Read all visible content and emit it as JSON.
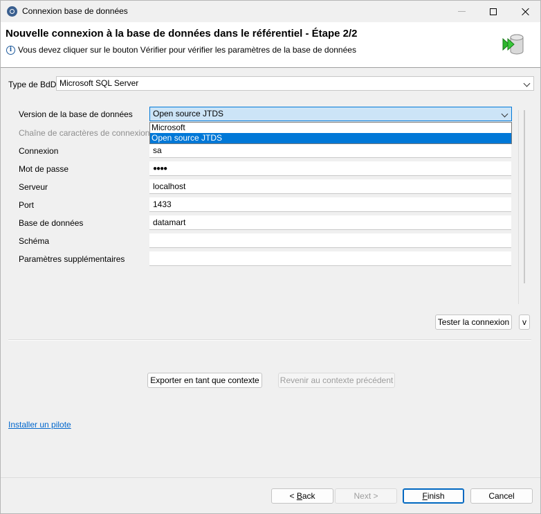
{
  "window": {
    "title": "Connexion base de données",
    "controls": {
      "minimize": "minimize-icon",
      "maximize": "maximize-icon",
      "close": "close-icon"
    }
  },
  "header": {
    "title": "Nouvelle connexion à la base de données dans le référentiel - Étape 2/2",
    "description": "Vous devez cliquer sur le bouton Vérifier pour vérifier les paramètres de la base de données",
    "info_icon": "i"
  },
  "db_type": {
    "label": "Type de BdD",
    "value": "Microsoft SQL Server"
  },
  "form": {
    "version_label": "Version de la base de données",
    "version_value": "Open source JTDS",
    "version_options": [
      "Microsoft",
      "Open source JTDS"
    ],
    "conn_string_label": "Chaîne de caractères de connexion",
    "login_label": "Connexion",
    "login_value": "sa",
    "password_label": "Mot de passe",
    "password_value": "●●●●",
    "server_label": "Serveur",
    "server_value": "localhost",
    "port_label": "Port",
    "port_value": "1433",
    "database_label": "Base de données",
    "database_value": "datamart",
    "schema_label": "Schéma",
    "schema_value": "",
    "extra_label": "Paramètres supplémentaires",
    "extra_value": ""
  },
  "actions": {
    "test_connection": "Tester la connexion",
    "test_menu": "v",
    "export_context": "Exporter en tant que contexte",
    "revert_context": "Revenir au contexte précédent",
    "install_driver": "Installer un pilote"
  },
  "footer": {
    "back_prefix": "< ",
    "back_mnemonic": "B",
    "back_rest": "ack",
    "next": "Next >",
    "finish_mnemonic": "F",
    "finish_rest": "inish",
    "cancel": "Cancel"
  },
  "colors": {
    "accent": "#0078d7",
    "link": "#0066cc",
    "selection": "#cce4f7"
  }
}
